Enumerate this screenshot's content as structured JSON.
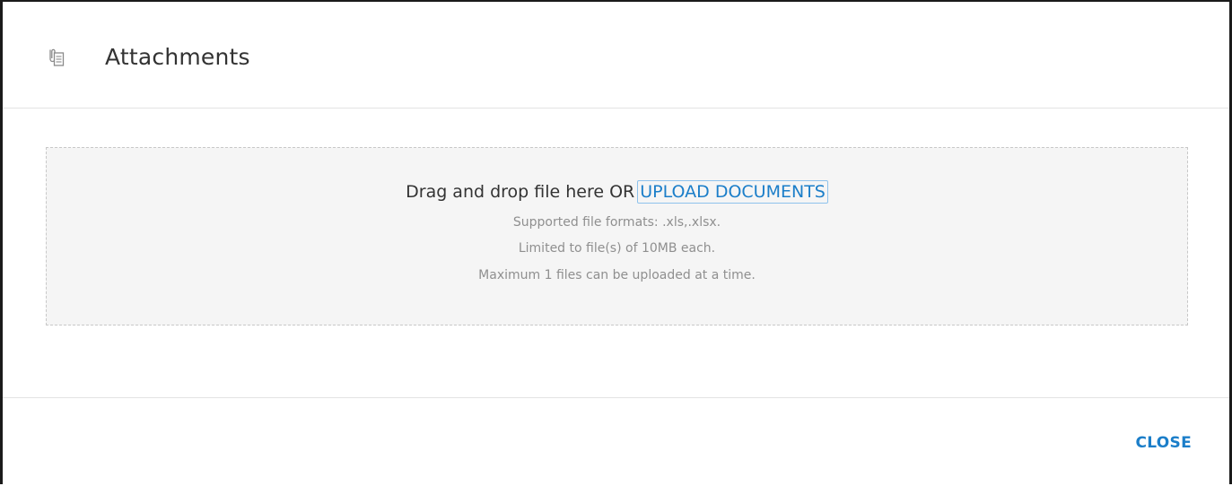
{
  "header": {
    "icon": "attachment-document-icon",
    "title": "Attachments"
  },
  "dropzone": {
    "prompt": "Drag and drop file here OR",
    "upload_label": "UPLOAD DOCUMENTS",
    "hints": [
      "Supported file formats: .xls,.xlsx.",
      "Limited to file(s) of 10MB each.",
      "Maximum 1 files can be uploaded at a time."
    ]
  },
  "footer": {
    "close_label": "CLOSE"
  },
  "colors": {
    "accent": "#1b7ec9",
    "dropzone_bg": "#f5f5f5",
    "hint_text": "#8f8f8f"
  }
}
